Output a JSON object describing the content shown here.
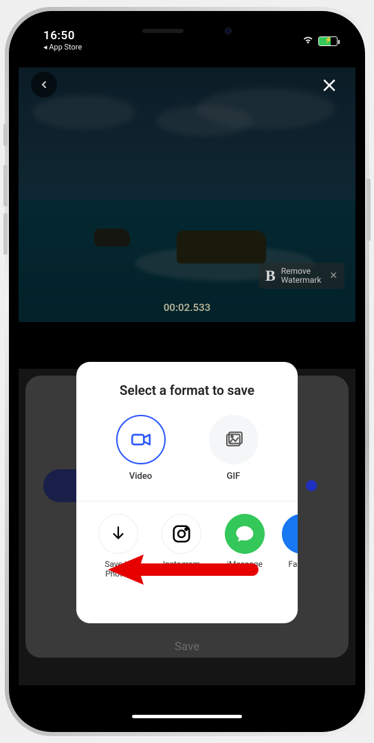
{
  "status": {
    "time": "16:50",
    "back_app_prefix": "◂ ",
    "back_app": "App Store"
  },
  "hero": {
    "watermark_line1": "Remove",
    "watermark_line2": "Watermark",
    "timecode": "00:02.533"
  },
  "bottom": {
    "save_label": "Save"
  },
  "sheet": {
    "title": "Select a format to save",
    "formats": {
      "video": "Video",
      "gif": "GIF"
    },
    "share": {
      "save_photos": "Save to Photos",
      "instagram": "Instagram",
      "imessage": "iMessage",
      "facebook": "Facebo"
    }
  }
}
